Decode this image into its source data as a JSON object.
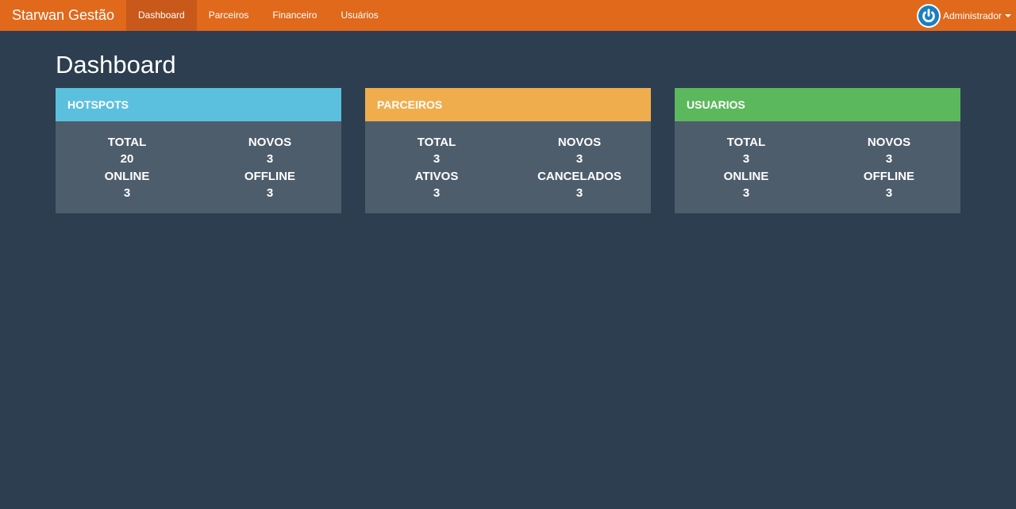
{
  "nav": {
    "brand": "Starwan Gestão",
    "items": [
      {
        "label": "Dashboard",
        "active": true
      },
      {
        "label": "Parceiros",
        "active": false
      },
      {
        "label": "Financeiro",
        "active": false
      },
      {
        "label": "Usuários",
        "active": false
      }
    ],
    "user": {
      "label": "Administrador",
      "icon": "power-icon",
      "dropdown_icon": "caret-down-icon"
    }
  },
  "page": {
    "title": "Dashboard"
  },
  "panels": [
    {
      "title": "HOTSPOTS",
      "color": "#5bc0de",
      "stats": [
        {
          "label": "TOTAL",
          "value": "20"
        },
        {
          "label": "NOVOS",
          "value": "3"
        },
        {
          "label": "ONLINE",
          "value": "3"
        },
        {
          "label": "OFFLINE",
          "value": "3"
        }
      ]
    },
    {
      "title": "PARCEIROS",
      "color": "#f0ad4e",
      "stats": [
        {
          "label": "TOTAL",
          "value": "3"
        },
        {
          "label": "NOVOS",
          "value": "3"
        },
        {
          "label": "ATIVOS",
          "value": "3"
        },
        {
          "label": "CANCELADOS",
          "value": "3"
        }
      ]
    },
    {
      "title": "USUARIOS",
      "color": "#5cb85c",
      "stats": [
        {
          "label": "TOTAL",
          "value": "3"
        },
        {
          "label": "NOVOS",
          "value": "3"
        },
        {
          "label": "ONLINE",
          "value": "3"
        },
        {
          "label": "OFFLINE",
          "value": "3"
        }
      ]
    }
  ]
}
